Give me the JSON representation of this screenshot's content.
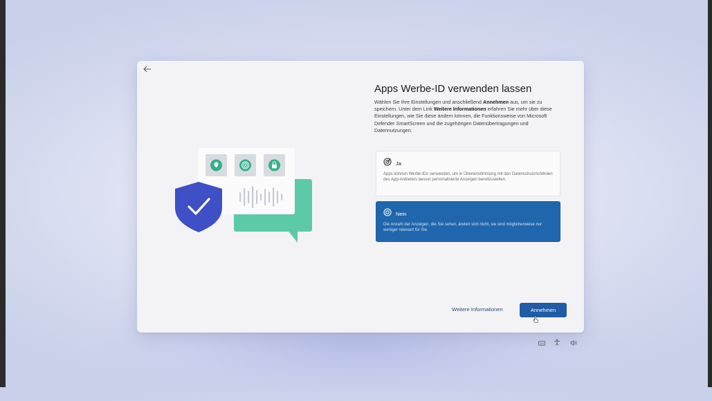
{
  "window": {
    "title": "Apps Werbe-ID verwenden lassen",
    "description": {
      "part1": "Wählen Sie Ihre Einstellungen und anschließend ",
      "bold1": "Annehmen",
      "part2": " aus, um sie zu speichern. Unter dem Link ",
      "bold2": "Weitere Informationen",
      "part3": " erfahren Sie mehr über diese Einstellungen, wie Sie diese ändern können, die Funktionsweise von Microsoft Defender SmartScreen und die zugehörigen Datenübertragungen und Datennutzungen."
    }
  },
  "options": [
    {
      "label": "Ja",
      "text": "Apps können Werbe-IDs verwenden, um in Übereinstimmung mit den Datenschutzrichtlinien des App-Anbieters besser personalisierte Anzeigen bereitzustellen.",
      "selected": false
    },
    {
      "label": "Nein",
      "text": "Die Anzahl der Anzeigen, die Sie sehen, ändert sich nicht, sie sind möglicherweise nur weniger relevant für Sie.",
      "selected": true
    }
  ],
  "footer": {
    "more_info": "Weitere Informationen",
    "accept": "Annehmen"
  },
  "icons": {
    "back": "back-arrow-icon",
    "option": "radio-target-icon",
    "tray": [
      "keyboard-icon",
      "accessibility-icon",
      "volume-icon"
    ]
  },
  "colors": {
    "accent": "#1f5ba6",
    "selected_option": "#2066ac",
    "illustration_teal": "#5ccaa6",
    "shield": "#3f4fc6"
  }
}
